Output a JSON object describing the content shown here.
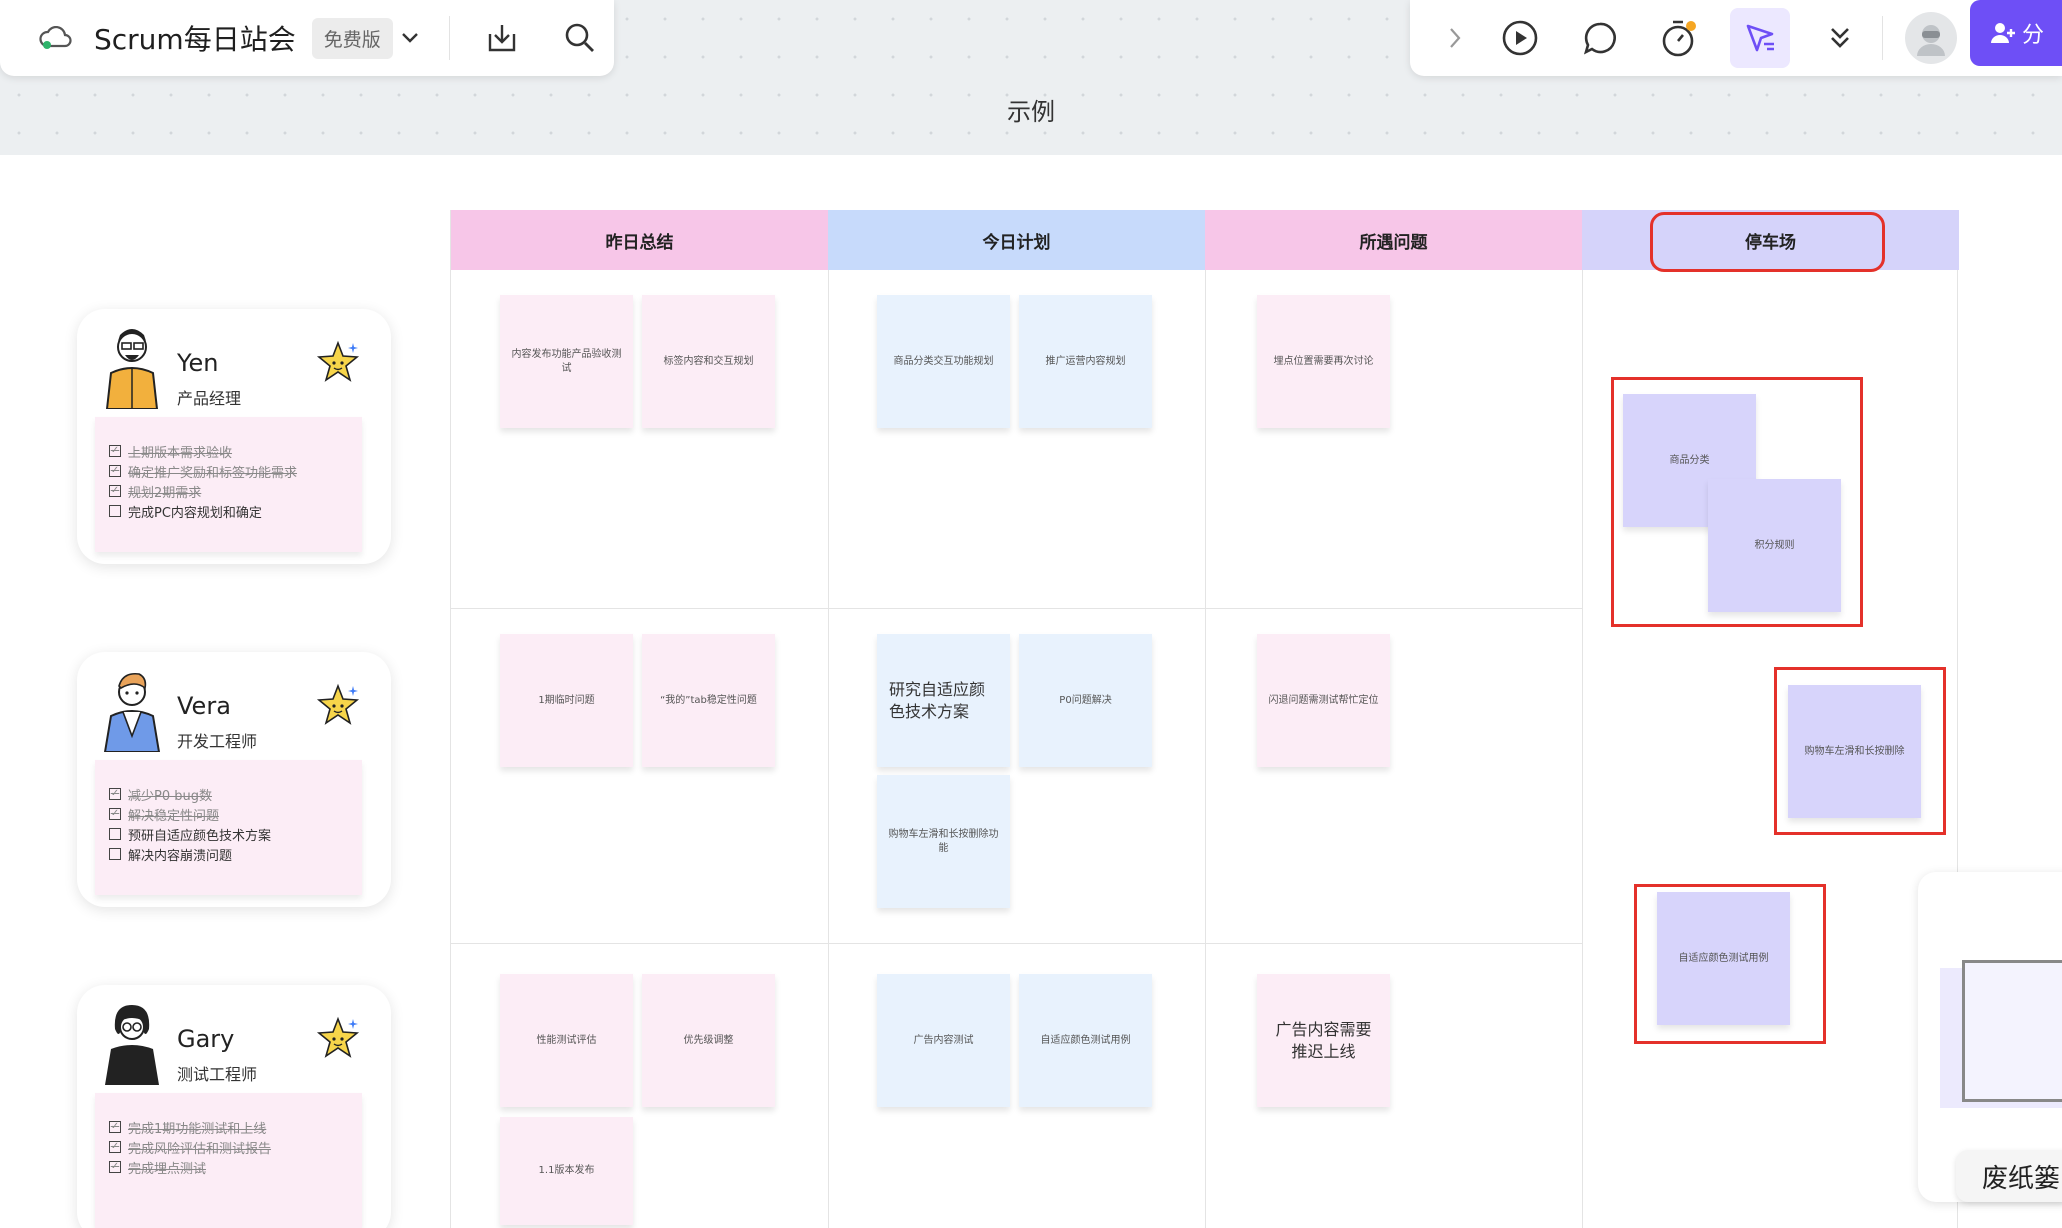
{
  "toolbar": {
    "doc_title": "Scrum每日站会",
    "plan_badge": "免费版",
    "share_label": "分"
  },
  "canvas": {
    "frame_title": "示例"
  },
  "board": {
    "columns": [
      {
        "label": "昨日总结",
        "color": "#f7c6e8"
      },
      {
        "label": "今日计划",
        "color": "#c7dafb"
      },
      {
        "label": "所遇问题",
        "color": "#f7c6e8"
      },
      {
        "label": "停车场",
        "color": "#d5d3fa"
      }
    ],
    "notes": {
      "yen_yesterday": [
        "内容发布功能产品验收测试",
        "标签内容和交互规划"
      ],
      "yen_today": [
        "商品分类交互功能规划",
        "推广运营内容规划"
      ],
      "yen_issues": [
        "埋点位置需要再次讨论"
      ],
      "vera_yesterday": [
        "1期临时问题",
        "“我的”tab稳定性问题"
      ],
      "vera_today": [
        "研究自适应颜色技术方案",
        "P0问题解决",
        "购物车左滑和长按删除功能"
      ],
      "vera_issues": [
        "闪退问题需测试帮忙定位"
      ],
      "gary_yesterday": [
        "性能测试评估",
        "优先级调整",
        "1.1版本发布"
      ],
      "gary_today": [
        "广告内容测试",
        "自适应颜色测试用例"
      ],
      "gary_issues": [
        "广告内容需要推迟上线"
      ],
      "parking": [
        "商品分类",
        "积分规则",
        "购物车左滑和长按删除",
        "自适应颜色测试用例"
      ]
    }
  },
  "people": [
    {
      "name": "Yen",
      "role": "产品经理",
      "tasks": [
        {
          "text": "上期版本需求验收",
          "done": true
        },
        {
          "text": "确定推广奖励和标签功能需求",
          "done": true
        },
        {
          "text": "规划2期需求",
          "done": true
        },
        {
          "text": "完成PC内容规划和确定",
          "done": false
        }
      ]
    },
    {
      "name": "Vera",
      "role": "开发工程师",
      "tasks": [
        {
          "text": "减少P0 bug数",
          "done": true
        },
        {
          "text": "解决稳定性问题",
          "done": true
        },
        {
          "text": "预研自适应颜色技术方案",
          "done": false
        },
        {
          "text": "解决内容崩溃问题",
          "done": false
        }
      ]
    },
    {
      "name": "Gary",
      "role": "测试工程师",
      "tasks": [
        {
          "text": "完成1期功能测试和上线",
          "done": true
        },
        {
          "text": "完成风险评估和测试报告",
          "done": true
        },
        {
          "text": "完成埋点测试",
          "done": true
        }
      ]
    }
  ],
  "side": {
    "trash_label": "废纸篓"
  },
  "colors": {
    "accent": "#6e4ff6",
    "highlight": "#e4312a"
  }
}
